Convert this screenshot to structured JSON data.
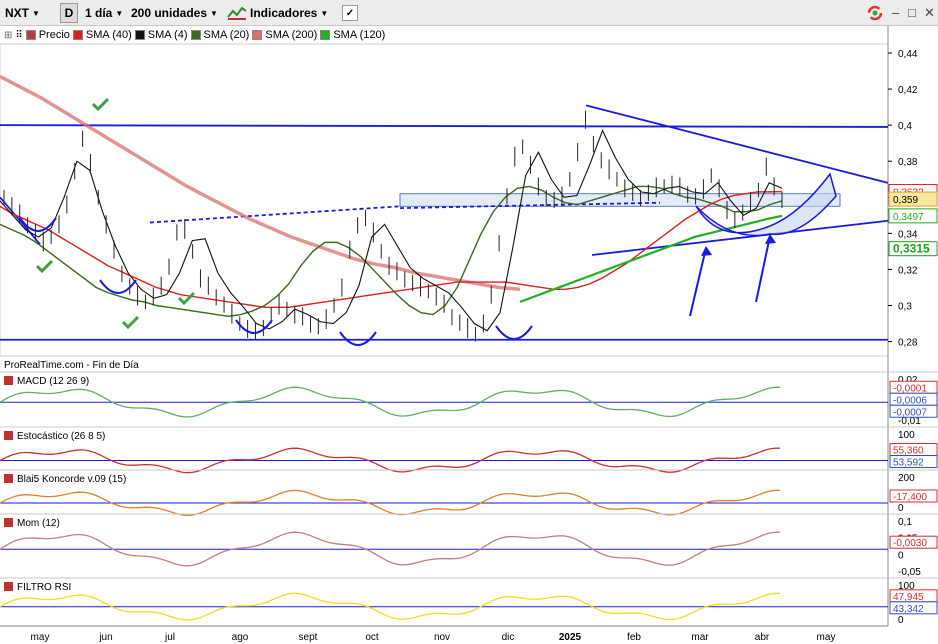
{
  "toolbar": {
    "symbol": "NXT",
    "draw_tool": "D",
    "period": "1 día",
    "units": "200 unidades",
    "indicators": "Indicadores"
  },
  "legend": [
    {
      "label": "Precio",
      "color": "#b04040"
    },
    {
      "label": "SMA (40)",
      "color": "#e02020"
    },
    {
      "label": "SMA (4)",
      "color": "#111111"
    },
    {
      "label": "SMA (20)",
      "color": "#3a6a1a"
    },
    {
      "label": "SMA (200)",
      "color": "#d87070"
    },
    {
      "label": "SMA (120)",
      "color": "#20b020"
    }
  ],
  "source_note": "ProRealTime.com - Fin de Día",
  "x_labels": [
    "may",
    "jun",
    "jul",
    "ago",
    "sept",
    "oct",
    "nov",
    "dic",
    "2025",
    "feb",
    "mar",
    "abr",
    "may"
  ],
  "panels": {
    "macd": {
      "title": "MACD (12 26 9)",
      "ticks": [
        "0,02",
        "0,01",
        "0",
        "-0,01"
      ],
      "values": [
        "-0,0001",
        "-0,0006",
        "-0,0007"
      ]
    },
    "stoch": {
      "title": "Estocástico (26 8 5)",
      "ticks": [
        "100",
        "0"
      ],
      "values": [
        "55,360",
        "53,592"
      ]
    },
    "koncorde": {
      "title": "Blai5 Koncorde v.09 (15)",
      "ticks": [
        "200",
        "0"
      ],
      "values": [
        "-17,400"
      ]
    },
    "mom": {
      "title": "Mom (12)",
      "ticks": [
        "0,1",
        "0,05",
        "0",
        "-0,05"
      ],
      "values": [
        "-0,0030"
      ]
    },
    "rsi": {
      "title": "FILTRO RSI",
      "ticks": [
        "100",
        "50",
        "0"
      ],
      "values": [
        "47,945",
        "43,342"
      ]
    }
  },
  "colors": {
    "trend": "#1a1ae0",
    "sma40": "#e02020",
    "sma20": "#3a6a1a",
    "sma200": "#d87070",
    "sma120": "#20b020"
  },
  "chart_data": {
    "type": "line",
    "title": "NXT",
    "y_ticks": [
      0.44,
      0.42,
      0.4,
      0.38,
      0.36,
      0.34,
      0.32,
      0.3,
      0.28
    ],
    "ylim": [
      0.272,
      0.445
    ],
    "price_labels": [
      {
        "value": 0.3632,
        "text": "0,3632"
      },
      {
        "value": 0.359,
        "text": "0,359"
      },
      {
        "value": 0.3497,
        "text": "0,3497"
      },
      {
        "value": 0.3315,
        "text": "0,3315"
      }
    ],
    "series": [
      {
        "name": "Precio",
        "values": [
          0.36,
          0.355,
          0.35,
          0.345,
          0.34,
          0.335,
          0.338,
          0.345,
          0.355,
          0.375,
          0.392,
          0.378,
          0.36,
          0.345,
          0.33,
          0.318,
          0.31,
          0.305,
          0.302,
          0.305,
          0.31,
          0.322,
          0.34,
          0.342,
          0.33,
          0.315,
          0.31,
          0.305,
          0.3,
          0.295,
          0.29,
          0.287,
          0.285,
          0.288,
          0.294,
          0.3,
          0.298,
          0.295,
          0.293,
          0.29,
          0.288,
          0.292,
          0.3,
          0.31,
          0.33,
          0.345,
          0.348,
          0.34,
          0.33,
          0.322,
          0.318,
          0.315,
          0.312,
          0.31,
          0.308,
          0.305,
          0.3,
          0.294,
          0.29,
          0.287,
          0.284,
          0.29,
          0.305,
          0.335,
          0.36,
          0.382,
          0.388,
          0.378,
          0.365,
          0.36,
          0.358,
          0.36,
          0.37,
          0.385,
          0.402,
          0.39,
          0.38,
          0.375,
          0.37,
          0.365,
          0.362,
          0.36,
          0.362,
          0.365,
          0.366,
          0.367,
          0.365,
          0.362,
          0.36,
          0.364,
          0.372,
          0.365,
          0.352,
          0.348,
          0.351,
          0.357,
          0.364,
          0.377,
          0.365,
          0.359
        ]
      },
      {
        "name": "SMA (40)",
        "values": [
          0.355,
          0.351,
          0.348,
          0.345,
          0.342,
          0.338,
          0.334,
          0.33,
          0.326,
          0.322,
          0.319,
          0.316,
          0.313,
          0.31,
          0.308,
          0.306,
          0.305,
          0.304,
          0.303,
          0.302,
          0.301,
          0.3,
          0.299,
          0.299,
          0.299,
          0.3,
          0.301,
          0.302,
          0.303,
          0.304,
          0.305,
          0.306,
          0.307,
          0.308,
          0.309,
          0.31,
          0.311,
          0.312,
          0.313,
          0.313,
          0.313,
          0.313,
          0.313,
          0.312,
          0.311,
          0.31,
          0.309,
          0.309,
          0.31,
          0.312,
          0.315,
          0.319,
          0.323,
          0.328,
          0.333,
          0.338,
          0.343,
          0.348,
          0.352,
          0.356,
          0.359,
          0.361,
          0.362,
          0.363,
          0.363,
          0.3632
        ]
      },
      {
        "name": "SMA (20)",
        "values": [
          0.345,
          0.342,
          0.339,
          0.335,
          0.33,
          0.325,
          0.32,
          0.315,
          0.31,
          0.307,
          0.305,
          0.303,
          0.302,
          0.3,
          0.299,
          0.298,
          0.297,
          0.296,
          0.295,
          0.294,
          0.295,
          0.297,
          0.3,
          0.305,
          0.312,
          0.322,
          0.33,
          0.335,
          0.335,
          0.332,
          0.327,
          0.32,
          0.313,
          0.306,
          0.3,
          0.296,
          0.295,
          0.3,
          0.31,
          0.325,
          0.34,
          0.352,
          0.36,
          0.365,
          0.366,
          0.364,
          0.36,
          0.357,
          0.356,
          0.358,
          0.36,
          0.362,
          0.364,
          0.366,
          0.366,
          0.365,
          0.362,
          0.36,
          0.359,
          0.357,
          0.355,
          0.352,
          0.352,
          0.353,
          0.356,
          0.358
        ]
      },
      {
        "name": "SMA (200)",
        "values": [
          0.427,
          0.421,
          0.415,
          0.408,
          0.401,
          0.394,
          0.387,
          0.38,
          0.373,
          0.366,
          0.36,
          0.354,
          0.348,
          0.343,
          0.338,
          0.334,
          0.33,
          0.326,
          0.323,
          0.321,
          0.318,
          0.316,
          0.314,
          0.312,
          0.31,
          0.309
        ]
      },
      {
        "name": "SMA (120)",
        "values": [
          0.302,
          0.305,
          0.308,
          0.311,
          0.314,
          0.317,
          0.32,
          0.323,
          0.326,
          0.329,
          0.332,
          0.335,
          0.338,
          0.34,
          0.342,
          0.344,
          0.346,
          0.348,
          0.3497
        ]
      },
      {
        "name": "SMA (4)",
        "values": [
          0.358,
          0.35,
          0.342,
          0.338,
          0.343,
          0.36,
          0.38,
          0.375,
          0.352,
          0.333,
          0.318,
          0.309,
          0.304,
          0.306,
          0.318,
          0.336,
          0.337,
          0.318,
          0.307,
          0.299,
          0.29,
          0.287,
          0.291,
          0.298,
          0.295,
          0.291,
          0.29,
          0.296,
          0.311,
          0.338,
          0.345,
          0.333,
          0.321,
          0.315,
          0.311,
          0.307,
          0.299,
          0.29,
          0.286,
          0.296,
          0.332,
          0.372,
          0.385,
          0.37,
          0.36,
          0.361,
          0.378,
          0.397,
          0.382,
          0.37,
          0.363,
          0.362,
          0.365,
          0.366,
          0.363,
          0.362,
          0.368,
          0.358,
          0.35,
          0.354,
          0.368,
          0.365
        ]
      }
    ]
  }
}
